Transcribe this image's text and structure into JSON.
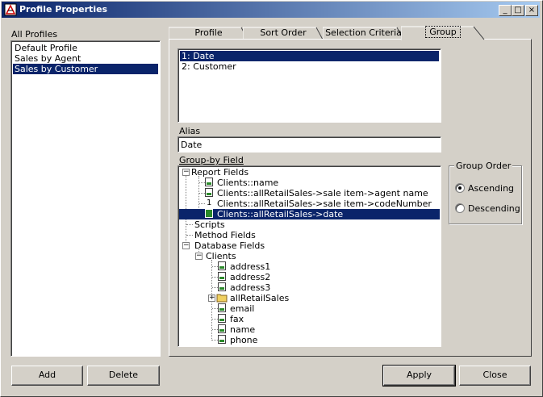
{
  "window": {
    "title": "Profile Properties",
    "minimize": "_",
    "maximize": "□",
    "close": "×"
  },
  "profiles": {
    "label": "All Profiles",
    "items": [
      "Default Profile",
      "Sales by Agent",
      "Sales by Customer"
    ],
    "selected": "Sales by Customer"
  },
  "tabs": [
    {
      "label": "Profile"
    },
    {
      "label": "Sort Order"
    },
    {
      "label": "Selection Criteria"
    },
    {
      "label": "Group",
      "active": true
    }
  ],
  "group_list": {
    "items": [
      "1: Date",
      "2: Customer"
    ],
    "selected": "1: Date"
  },
  "alias": {
    "label": "Alias",
    "value": "Date"
  },
  "groupby": {
    "label": "Group-by Field",
    "tree": {
      "report_fields": "Report Fields",
      "report_children": [
        {
          "label": "Clients::name",
          "icon": "alpha-field-icon"
        },
        {
          "label": "Clients::allRetailSales->sale item->agent name",
          "icon": "alpha-field-icon"
        },
        {
          "label": "Clients::allRetailSales->sale item->codeNumber",
          "icon": "number-field-icon"
        },
        {
          "label": "Clients::allRetailSales->date",
          "icon": "date-field-icon",
          "selected": true
        }
      ],
      "scripts": "Scripts",
      "method_fields": "Method Fields",
      "database_fields": "Database Fields",
      "clients": "Clients",
      "client_children": [
        {
          "label": "address1",
          "icon": "alpha-field-icon"
        },
        {
          "label": "address2",
          "icon": "alpha-field-icon"
        },
        {
          "label": "address3",
          "icon": "alpha-field-icon"
        },
        {
          "label": "allRetailSales",
          "icon": "folder-icon"
        },
        {
          "label": "email",
          "icon": "alpha-field-icon"
        },
        {
          "label": "fax",
          "icon": "alpha-field-icon"
        },
        {
          "label": "name",
          "icon": "alpha-field-icon"
        },
        {
          "label": "phone",
          "icon": "alpha-field-icon"
        }
      ]
    }
  },
  "group_order": {
    "label": "Group Order",
    "ascending": "Ascending",
    "descending": "Descending",
    "selected": "Ascending"
  },
  "buttons": {
    "add": "Add",
    "delete": "Delete",
    "apply": "Apply",
    "close": "Close"
  }
}
